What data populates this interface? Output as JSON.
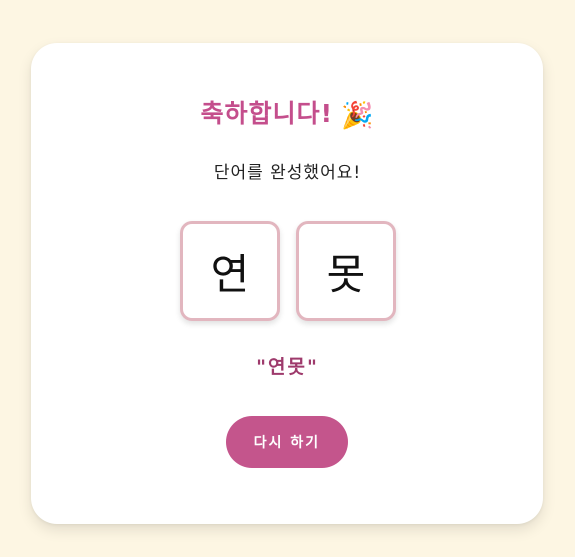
{
  "result": {
    "title": "축하합니다!",
    "title_emoji": "🎉",
    "subtitle": "단어를 완성했어요!",
    "tiles": [
      "연",
      "못"
    ],
    "word": "\"연못\"",
    "retry_label": "다시 하기"
  },
  "colors": {
    "background": "#fdf6e3",
    "accent": "#c44e8c",
    "tile_border": "#e2b6bf",
    "button": "#c4558c"
  }
}
